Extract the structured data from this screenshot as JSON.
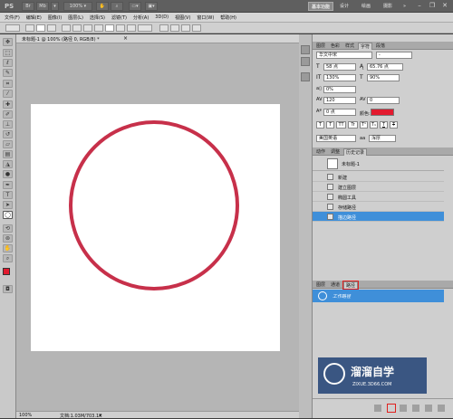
{
  "app": {
    "logo": "PS",
    "zoom": "100%"
  },
  "workspace": {
    "buttons": [
      "基本功能",
      "设计",
      "绘画",
      "摄影"
    ],
    "more": "»"
  },
  "menu": [
    "文件(F)",
    "编辑(E)",
    "图像(I)",
    "图层(L)",
    "选择(S)",
    "滤镜(T)",
    "分析(A)",
    "3D(D)",
    "视图(V)",
    "窗口(W)",
    "帮助(H)"
  ],
  "document": {
    "tab_label": "未标题-1 @ 100% (路径 0, RGB/8) *",
    "status_zoom": "100%",
    "status_doc": "文档:1.03M/703.1K"
  },
  "colors": {
    "stroke": "#c7304a",
    "fg": "#e21a2e",
    "selection": "#3f8fd9",
    "canvas": "#ffffff"
  },
  "char_panel": {
    "tabs": [
      "图层",
      "色彩",
      "样式",
      "字符",
      "段落"
    ],
    "active_tab": "字符",
    "font_family": "华文中宋",
    "font_style": "-",
    "font_size": "58 点",
    "leading": "65.76 点",
    "vscale": "130%",
    "hscale": "90%",
    "tracking_pct": "0%",
    "tracking": "120",
    "kerning": "0",
    "baseline": "0 点",
    "color_label": "颜色:",
    "styles": [
      "T",
      "T",
      "TT",
      "Tr",
      "T¹",
      "T₁",
      "T",
      "T"
    ],
    "language": "美国英语",
    "aa_label": "aa",
    "antialias": "浑厚"
  },
  "history_panel": {
    "tabs": [
      "动作",
      "调整",
      "历史记录"
    ],
    "active_tab": "历史记录",
    "snapshot": "未标题-1",
    "items": [
      "新建",
      "建立图层",
      "椭圆工具",
      "存储路径",
      "描边路径"
    ],
    "selected": 4
  },
  "paths_panel": {
    "tabs": [
      "图层",
      "通道",
      "路径"
    ],
    "active_tab": "路径",
    "items": [
      "工作路径"
    ]
  },
  "watermark": {
    "text": "溜溜自学",
    "url": "ZIXUE.3D66.COM"
  }
}
